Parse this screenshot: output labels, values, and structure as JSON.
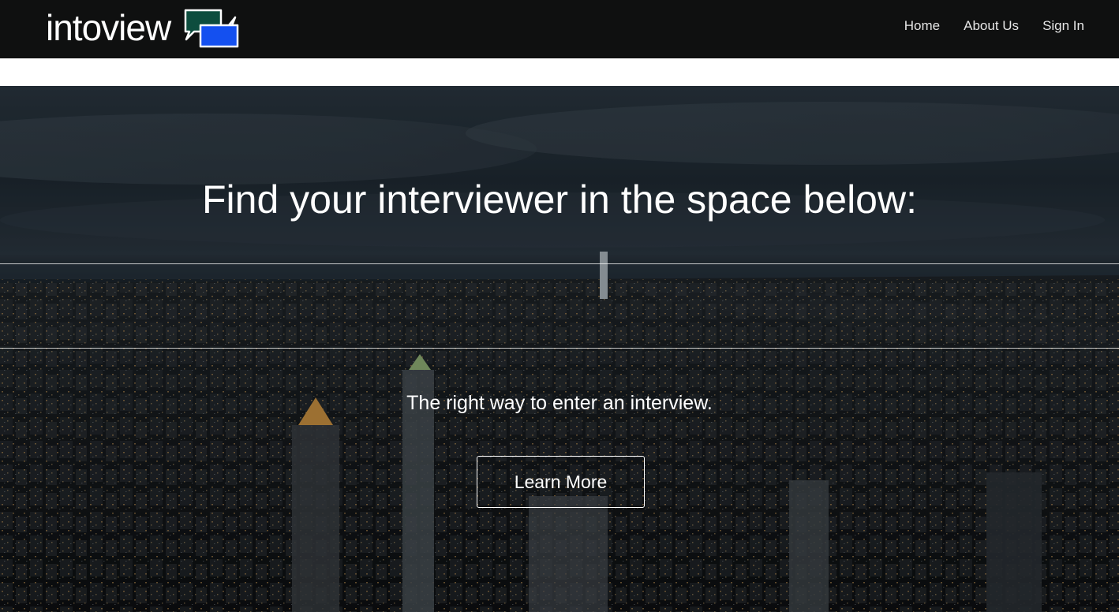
{
  "navbar": {
    "brand": "intoview",
    "links": [
      {
        "label": "Home"
      },
      {
        "label": "About Us"
      },
      {
        "label": "Sign In"
      }
    ]
  },
  "hero": {
    "title": "Find your interviewer in the space below:",
    "search": {
      "value": "",
      "placeholder": ""
    },
    "tagline": "The right way to enter an interview.",
    "cta_label": "Learn More"
  },
  "colors": {
    "navbar_bg": "#0f1010",
    "logo_bubble_green": "#0d4d3e",
    "logo_bubble_blue": "#1450f0",
    "text_light": "#ffffff"
  },
  "icons": {
    "logo": "chat-bubbles-icon"
  }
}
